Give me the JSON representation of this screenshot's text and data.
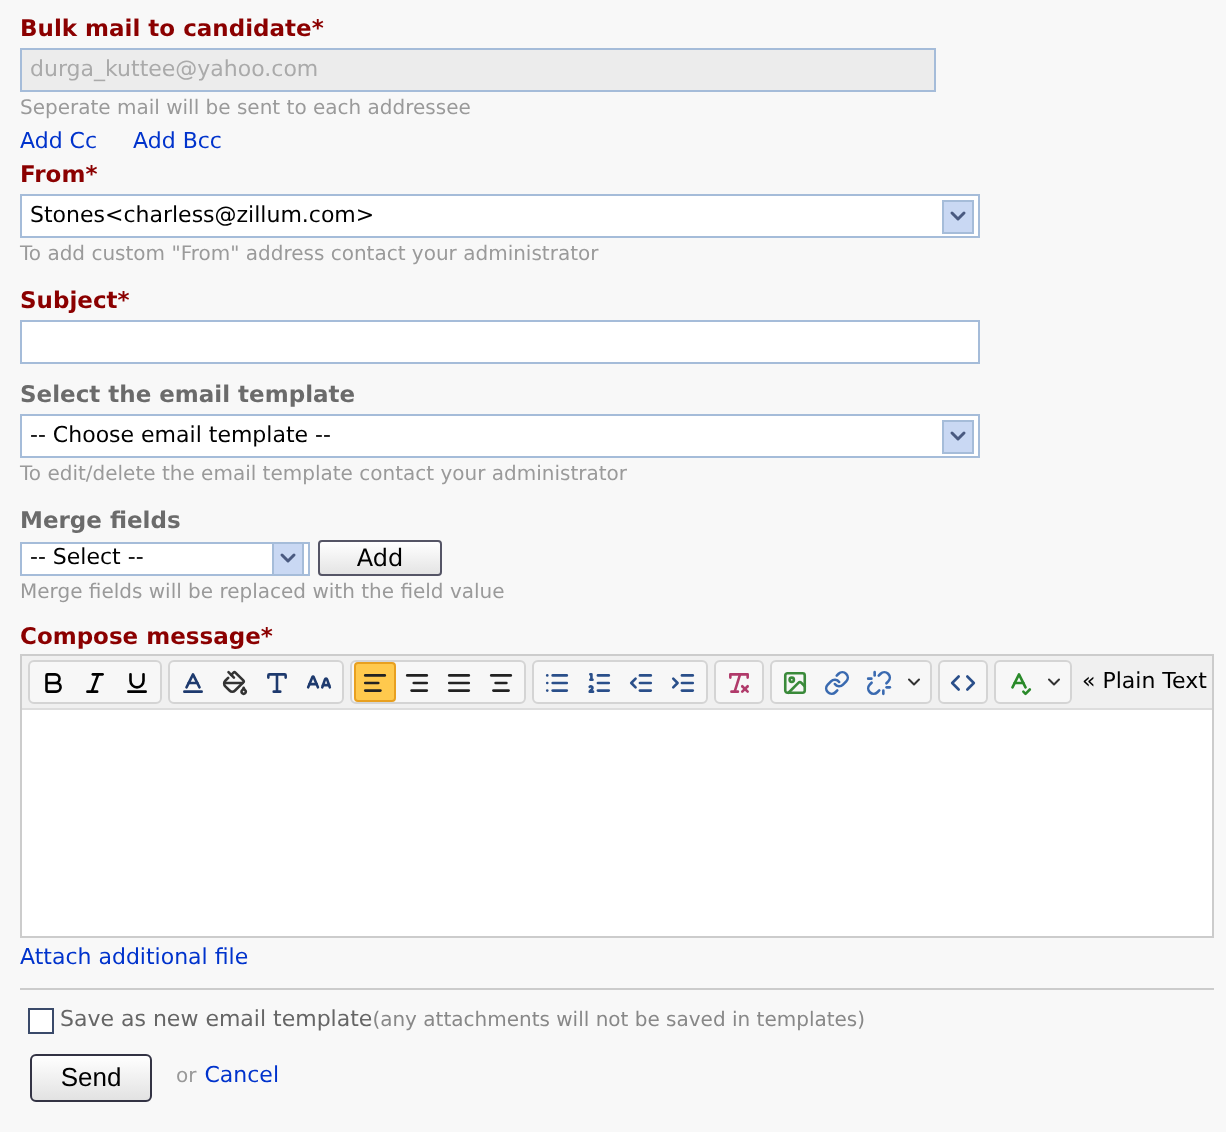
{
  "recipient": {
    "label": "Bulk mail to candidate",
    "required": true,
    "value": "durga_kuttee@yahoo.com",
    "disabled": true,
    "hint": "Seperate mail will be sent to each addressee"
  },
  "recipient_links": [
    "Add Cc",
    "Add Bcc"
  ],
  "from": {
    "label": "From",
    "required": true,
    "value": "Stones<charless@zillum.com>",
    "hint": "To add custom \"From\" address contact your administrator"
  },
  "subject": {
    "label": "Subject",
    "required": true
  },
  "template": {
    "label": "Select the email template",
    "required": false,
    "value": "-- Choose email template --",
    "hint": "To edit/delete the email template contact your administrator"
  },
  "merge_fields": {
    "label": "Merge fields",
    "required": false,
    "value": "-- Select --",
    "button": "Add",
    "hint": "Merge fields will be replaced with the field value"
  },
  "compose": {
    "label": "Compose message",
    "required": true,
    "toolbar": [
      [
        {
          "kind": "bold",
          "selected": false
        },
        {
          "kind": "italic",
          "selected": false
        },
        {
          "kind": "underline",
          "selected": false
        }
      ],
      [
        {
          "kind": "font-color",
          "selected": false
        },
        {
          "kind": "highlight",
          "selected": false
        },
        {
          "kind": "font-family",
          "selected": false
        },
        {
          "kind": "font-size",
          "selected": false
        }
      ],
      [
        {
          "kind": "align-left",
          "selected": true
        },
        {
          "kind": "align-right",
          "selected": false
        },
        {
          "kind": "justify",
          "selected": false
        },
        {
          "kind": "align-center",
          "selected": false
        }
      ],
      [
        {
          "kind": "bullets",
          "selected": false
        },
        {
          "kind": "numbering",
          "selected": false
        },
        {
          "kind": "outdent",
          "selected": false
        },
        {
          "kind": "indent",
          "selected": false
        }
      ],
      [
        {
          "kind": "clear-format",
          "selected": false
        }
      ],
      [
        {
          "kind": "image",
          "selected": false
        },
        {
          "kind": "link",
          "selected": false
        },
        {
          "kind": "unlink",
          "selected": false
        },
        {
          "kind": "dropdown",
          "selected": false
        }
      ],
      [
        {
          "kind": "html",
          "selected": false
        }
      ],
      [
        {
          "kind": "spellcheck",
          "selected": false
        },
        {
          "kind": "dropdown",
          "selected": false
        }
      ]
    ],
    "mode_link": "« Plain Text"
  },
  "attach_link": "Attach additional file",
  "save_template": {
    "label": "Save as new email template",
    "note": "(any attachments will not be saved in templates)",
    "checked": false
  },
  "required_mark": "*",
  "send_button": "Send",
  "or_text": "or",
  "cancel_link": "Cancel"
}
